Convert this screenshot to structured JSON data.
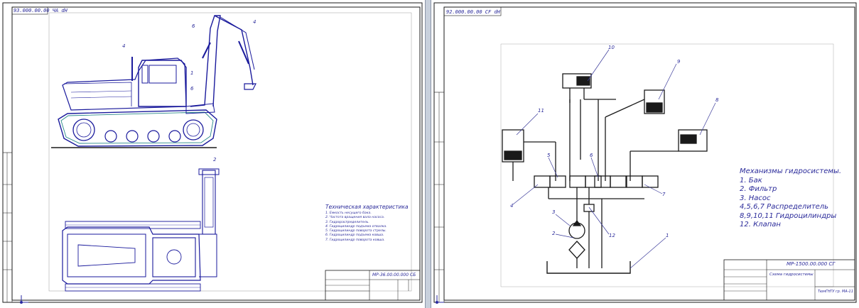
{
  "left_sheet": {
    "stamp": "93.000.00.00 ЧА dН",
    "title_block_code": "МР-36.00.00.000 СБ",
    "tech_title": "Техническая характеристика",
    "tech_items": [
      "1. Емкость несущего бака.",
      "2. Частота вращения вала насоса.",
      "3. Гидрораспределитель.",
      "4. Гидроцилиндр подъема отвалка.",
      "5. Гидроцилиндр поворота стрелы.",
      "6. Гидроцилиндр подъема ковша.",
      "7. Гидроцилиндр поворота ковша."
    ],
    "callouts": [
      "4",
      "6",
      "1",
      "6",
      "4",
      "2"
    ]
  },
  "right_sheet": {
    "stamp": "92.000.00.00 CF dH",
    "title_block_code": "МР-1500.00.000 СГ",
    "title_block_subtitle": "Схема гидросистемы",
    "title_block_org": "ТюмГНГУ гр. МА-11",
    "legend_title": "Механизмы гидросистемы.",
    "legend_items": [
      "1. Бак",
      "2. Фильтр",
      "3. Насос",
      "4,5,6,7 Распределитель",
      "8,9,10,11 Гидроцилиндры",
      "12. Клапан"
    ],
    "callouts": [
      "10",
      "9",
      "8",
      "11",
      "5",
      "6",
      "4",
      "7",
      "3",
      "12",
      "2",
      "1"
    ]
  },
  "colors": {
    "line": "#1a1a9c",
    "border": "#1a1a1a",
    "accent": "#2a8a8a",
    "leader": "#3a3a9a"
  },
  "icons": [
    "view-corner-icon"
  ]
}
